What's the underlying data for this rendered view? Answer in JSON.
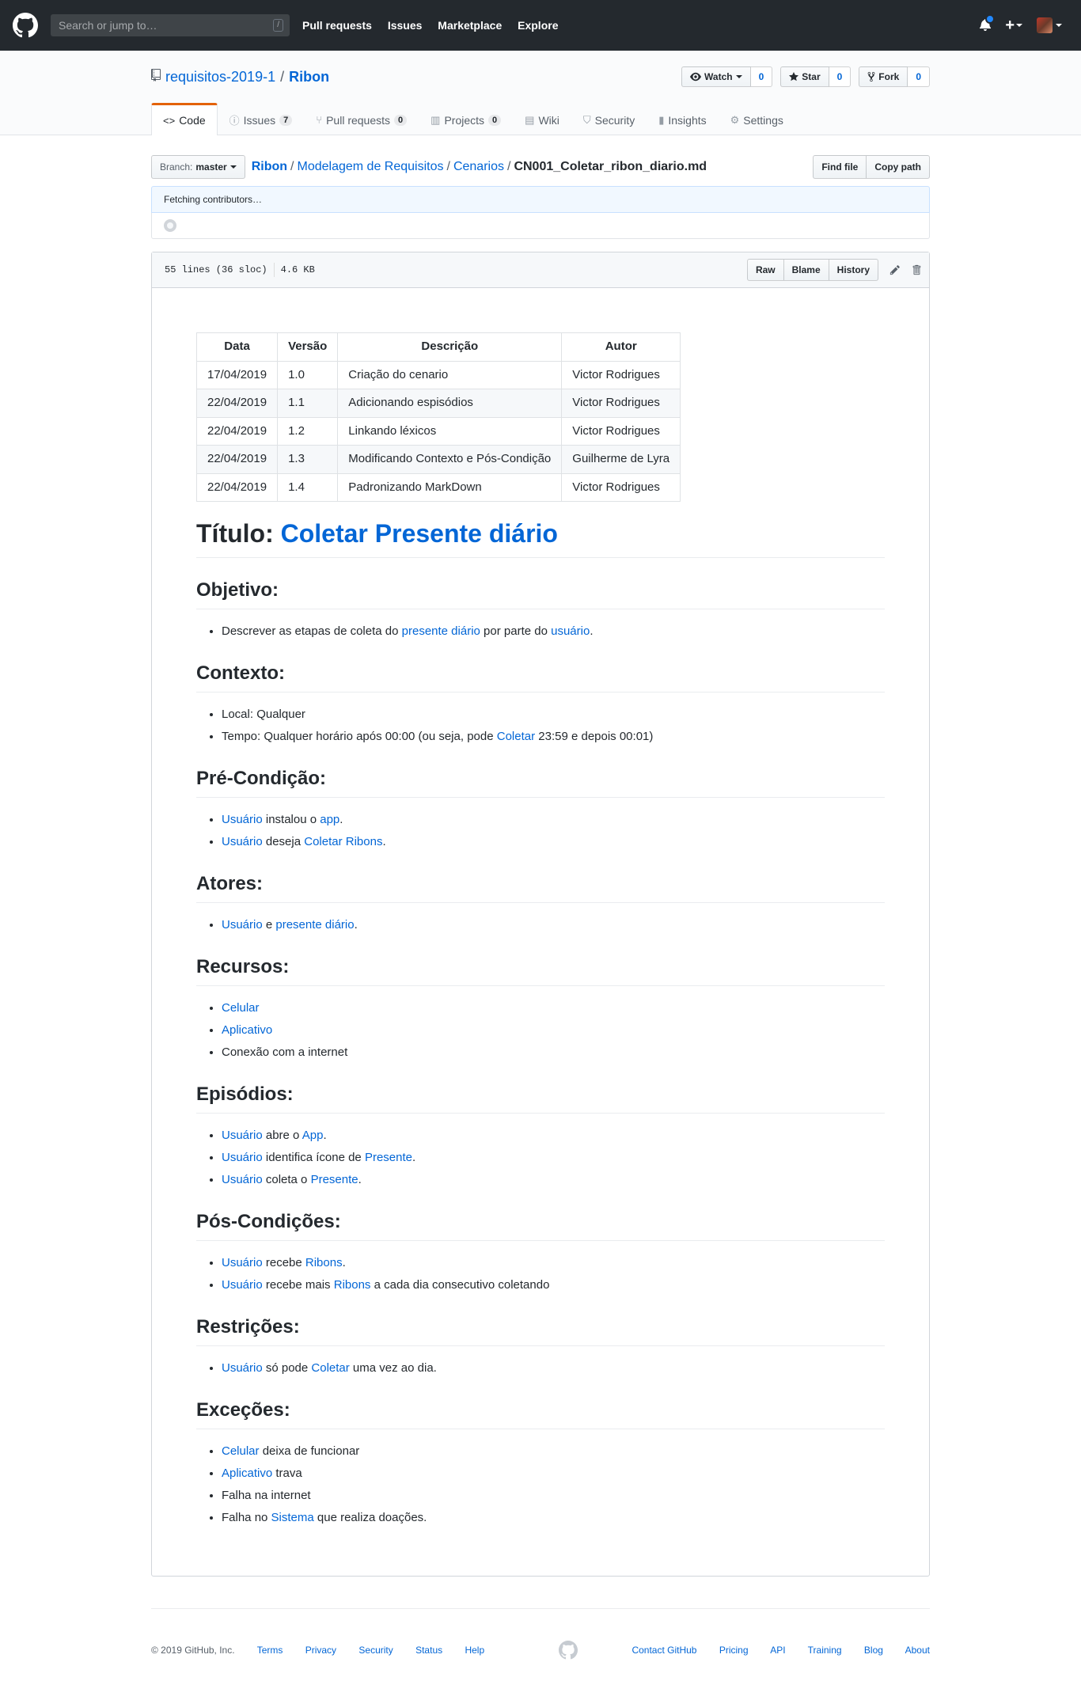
{
  "header": {
    "search_placeholder": "Search or jump to…",
    "slash_key": "/",
    "nav": [
      "Pull requests",
      "Issues",
      "Marketplace",
      "Explore"
    ],
    "plus": "+"
  },
  "repo": {
    "owner": "requisitos-2019-1",
    "separator": "/",
    "name": "Ribon",
    "watch_label": "Watch",
    "watch_count": "0",
    "star_label": "Star",
    "star_count": "0",
    "fork_label": "Fork",
    "fork_count": "0"
  },
  "tabs": [
    {
      "label": "Code",
      "icon": "code-icon"
    },
    {
      "label": "Issues",
      "count": "7",
      "icon": "issue-icon"
    },
    {
      "label": "Pull requests",
      "count": "0",
      "icon": "pr-icon"
    },
    {
      "label": "Projects",
      "count": "0",
      "icon": "project-icon"
    },
    {
      "label": "Wiki",
      "icon": "wiki-icon"
    },
    {
      "label": "Security",
      "icon": "shield-icon"
    },
    {
      "label": "Insights",
      "icon": "graph-icon"
    },
    {
      "label": "Settings",
      "icon": "gear-icon"
    }
  ],
  "file_nav": {
    "branch_prefix": "Branch:",
    "branch": "master",
    "breadcrumb": [
      "Ribon",
      "Modelagem de Requisitos",
      "Cenarios"
    ],
    "filename": "CN001_Coletar_ribon_diario.md",
    "find_file": "Find file",
    "copy_path": "Copy path"
  },
  "commit": {
    "fetching": "Fetching contributors…"
  },
  "file_info": {
    "lines": "55 lines (36 sloc)",
    "size": "4.6 KB",
    "raw": "Raw",
    "blame": "Blame",
    "history": "History"
  },
  "doc": {
    "table": {
      "headers": [
        "Data",
        "Versão",
        "Descrição",
        "Autor"
      ],
      "rows": [
        [
          "17/04/2019",
          "1.0",
          "Criação do cenario",
          "Victor Rodrigues"
        ],
        [
          "22/04/2019",
          "1.1",
          "Adicionando espisódios",
          "Victor Rodrigues"
        ],
        [
          "22/04/2019",
          "1.2",
          "Linkando léxicos",
          "Victor Rodrigues"
        ],
        [
          "22/04/2019",
          "1.3",
          "Modificando Contexto e Pós-Condição",
          "Guilherme de Lyra"
        ],
        [
          "22/04/2019",
          "1.4",
          "Padronizando MarkDown",
          "Victor Rodrigues"
        ]
      ]
    },
    "title_prefix": "Título:",
    "title_link": "Coletar Presente diário",
    "sections": [
      {
        "heading": "Objetivo:",
        "items": [
          [
            {
              "t": "Descrever as etapas de coleta do "
            },
            {
              "t": "presente diário",
              "link": true
            },
            {
              "t": " por parte do "
            },
            {
              "t": "usuário",
              "link": true
            },
            {
              "t": "."
            }
          ]
        ]
      },
      {
        "heading": "Contexto:",
        "items": [
          [
            {
              "t": "Local: Qualquer"
            }
          ],
          [
            {
              "t": "Tempo: Qualquer horário após 00:00 (ou seja, pode "
            },
            {
              "t": "Coletar",
              "link": true
            },
            {
              "t": " 23:59 e depois 00:01)"
            }
          ]
        ]
      },
      {
        "heading": "Pré-Condição:",
        "items": [
          [
            {
              "t": "Usuário",
              "link": true
            },
            {
              "t": " instalou o "
            },
            {
              "t": "app",
              "link": true
            },
            {
              "t": "."
            }
          ],
          [
            {
              "t": "Usuário",
              "link": true
            },
            {
              "t": " deseja "
            },
            {
              "t": "Coletar Ribons",
              "link": true
            },
            {
              "t": "."
            }
          ]
        ]
      },
      {
        "heading": "Atores:",
        "items": [
          [
            {
              "t": "Usuário",
              "link": true
            },
            {
              "t": " e "
            },
            {
              "t": "presente diário",
              "link": true
            },
            {
              "t": "."
            }
          ]
        ]
      },
      {
        "heading": "Recursos:",
        "items": [
          [
            {
              "t": "Celular",
              "link": true
            }
          ],
          [
            {
              "t": "Aplicativo",
              "link": true
            }
          ],
          [
            {
              "t": "Conexão com a internet"
            }
          ]
        ]
      },
      {
        "heading": "Episódios:",
        "items": [
          [
            {
              "t": "Usuário",
              "link": true
            },
            {
              "t": " abre o "
            },
            {
              "t": "App",
              "link": true
            },
            {
              "t": "."
            }
          ],
          [
            {
              "t": "Usuário",
              "link": true
            },
            {
              "t": " identifica ícone de "
            },
            {
              "t": "Presente",
              "link": true
            },
            {
              "t": "."
            }
          ],
          [
            {
              "t": "Usuário",
              "link": true
            },
            {
              "t": " coleta o "
            },
            {
              "t": "Presente",
              "link": true
            },
            {
              "t": "."
            }
          ]
        ]
      },
      {
        "heading": "Pós-Condições:",
        "items": [
          [
            {
              "t": "Usuário",
              "link": true
            },
            {
              "t": " recebe "
            },
            {
              "t": "Ribons",
              "link": true
            },
            {
              "t": "."
            }
          ],
          [
            {
              "t": "Usuário",
              "link": true
            },
            {
              "t": " recebe mais "
            },
            {
              "t": "Ribons",
              "link": true
            },
            {
              "t": " a cada dia consecutivo coletando"
            }
          ]
        ]
      },
      {
        "heading": "Restrições:",
        "items": [
          [
            {
              "t": "Usuário",
              "link": true
            },
            {
              "t": " só pode "
            },
            {
              "t": "Coletar",
              "link": true
            },
            {
              "t": " uma vez ao dia."
            }
          ]
        ]
      },
      {
        "heading": "Exceções:",
        "items": [
          [
            {
              "t": "Celular",
              "link": true
            },
            {
              "t": " deixa de funcionar"
            }
          ],
          [
            {
              "t": "Aplicativo",
              "link": true
            },
            {
              "t": " trava"
            }
          ],
          [
            {
              "t": "Falha na internet"
            }
          ],
          [
            {
              "t": "Falha no "
            },
            {
              "t": "Sistema",
              "link": true
            },
            {
              "t": " que realiza doações."
            }
          ]
        ]
      }
    ]
  },
  "footer": {
    "copyright": "© 2019 GitHub, Inc.",
    "left_links": [
      "Terms",
      "Privacy",
      "Security",
      "Status",
      "Help"
    ],
    "right_links": [
      "Contact GitHub",
      "Pricing",
      "API",
      "Training",
      "Blog",
      "About"
    ]
  }
}
